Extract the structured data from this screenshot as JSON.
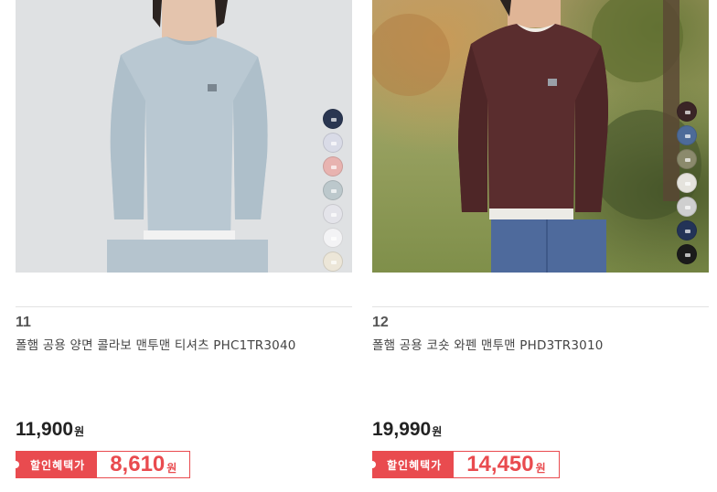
{
  "products": [
    {
      "rank": "11",
      "name": "폴햄 공용 양면 콜라보 맨투맨 티셔츠 PHC1TR3040",
      "price": "11,900",
      "currency": "원",
      "sale_label": "할인혜택가",
      "sale_price": "8,610",
      "image_alt": "light blue crewneck sweatshirt",
      "swatch_colors": [
        "#2a3651",
        "#d9dbe7",
        "#e8b3b0",
        "#bcc8cc",
        "#e4e4ea",
        "#f3f3f5",
        "#ece6d8",
        "#141414"
      ]
    },
    {
      "rank": "12",
      "name": "폴햄 공용 코숏 와펜 맨투맨 PHD3TR3010",
      "price": "19,990",
      "currency": "원",
      "sale_label": "할인혜택가",
      "sale_price": "14,450",
      "image_alt": "brown crewneck sweatshirt outdoors",
      "swatch_colors": [
        "#3a2526",
        "#4d6b99",
        "#8b8a6c",
        "#e5e3dd",
        "#cfcfcf",
        "#233357",
        "#1b1b1b"
      ]
    }
  ],
  "colors": {
    "accent": "#e94b4f"
  }
}
